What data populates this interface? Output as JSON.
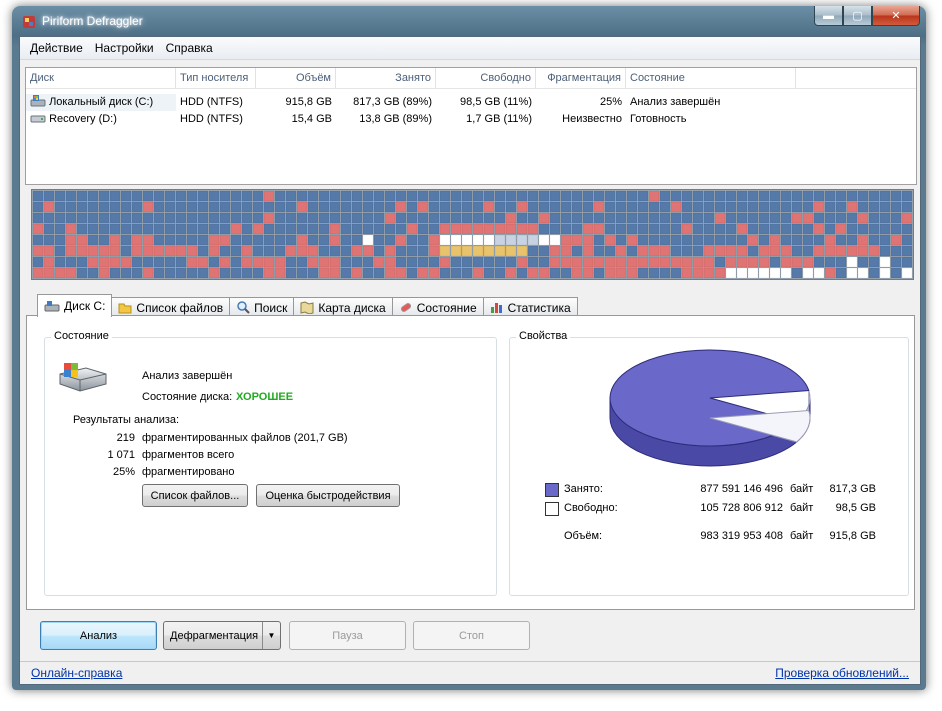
{
  "window": {
    "title": "Piriform Defraggler"
  },
  "titlebar_buttons": {
    "minimize": "▬",
    "maximize": "▢",
    "close": "✕"
  },
  "menu": [
    "Действие",
    "Настройки",
    "Справка"
  ],
  "drive_table": {
    "columns": [
      "Диск",
      "Тип носителя",
      "Объём",
      "Занято",
      "Свободно",
      "Фрагментация",
      "Состояние"
    ],
    "rows": [
      {
        "name": "Локальный диск (C:)",
        "type": "HDD (NTFS)",
        "size": "915,8 GB",
        "used": "817,3 GB (89%)",
        "free": "98,5 GB (11%)",
        "frag": "25%",
        "state": "Анализ завершён",
        "icon": "hdd-system-icon"
      },
      {
        "name": "Recovery (D:)",
        "type": "HDD (NTFS)",
        "size": "15,4 GB",
        "used": "13,8 GB (89%)",
        "free": "1,7 GB (11%)",
        "frag": "Неизвестно",
        "state": "Готовность",
        "icon": "hdd-icon"
      }
    ]
  },
  "disk_map": {
    "colors": {
      "used": "#5579a8",
      "fragmented": "#e07474",
      "free": "#ffffff",
      "system": "#e8c36c",
      "unused_light": "#c7d3e2"
    }
  },
  "tabs": [
    {
      "label": "Диск C:",
      "icon": "drive-icon",
      "active": true
    },
    {
      "label": "Список файлов",
      "icon": "folder-icon"
    },
    {
      "label": "Поиск",
      "icon": "search-icon"
    },
    {
      "label": "Карта диска",
      "icon": "map-icon"
    },
    {
      "label": "Состояние",
      "icon": "health-icon"
    },
    {
      "label": "Статистика",
      "icon": "chart-icon"
    }
  ],
  "status_group": {
    "title": "Состояние",
    "analysis": "Анализ завершён",
    "disk_state_label": "Состояние диска:",
    "disk_state_value": "ХОРОШЕЕ",
    "disk_state_color": "#22aa22",
    "results_label": "Результаты анализа:",
    "results": [
      {
        "value": "219",
        "text": "фрагментированных файлов (201,7 GB)"
      },
      {
        "value": "1 071",
        "text": "фрагментов всего"
      },
      {
        "value": "25%",
        "text": "фрагментировано"
      }
    ],
    "file_list_button": "Список файлов...",
    "benchmark_button": "Оценка быстродействия"
  },
  "properties_group": {
    "title": "Свойства",
    "rows": [
      {
        "label": "Занято:",
        "bytes": "877 591 146 496",
        "unit": "байт",
        "size": "817,3 GB",
        "swatch": "#6a68c8"
      },
      {
        "label": "Свободно:",
        "bytes": "105 728 806 912",
        "unit": "байт",
        "size": "98,5 GB",
        "swatch": "#ffffff"
      },
      {
        "label": "Объём:",
        "bytes": "983 319 953 408",
        "unit": "байт",
        "size": "915,8 GB"
      }
    ],
    "pie": {
      "used_fraction": 0.892,
      "used_color": "#6a68c8",
      "free_color": "#f4f4fb"
    }
  },
  "buttons": {
    "analyze": "Анализ",
    "defrag": "Дефрагментация",
    "pause": "Пауза",
    "stop": "Стоп"
  },
  "footer": {
    "help_link": "Онлайн-справка",
    "update_link": "Проверка обновлений..."
  }
}
